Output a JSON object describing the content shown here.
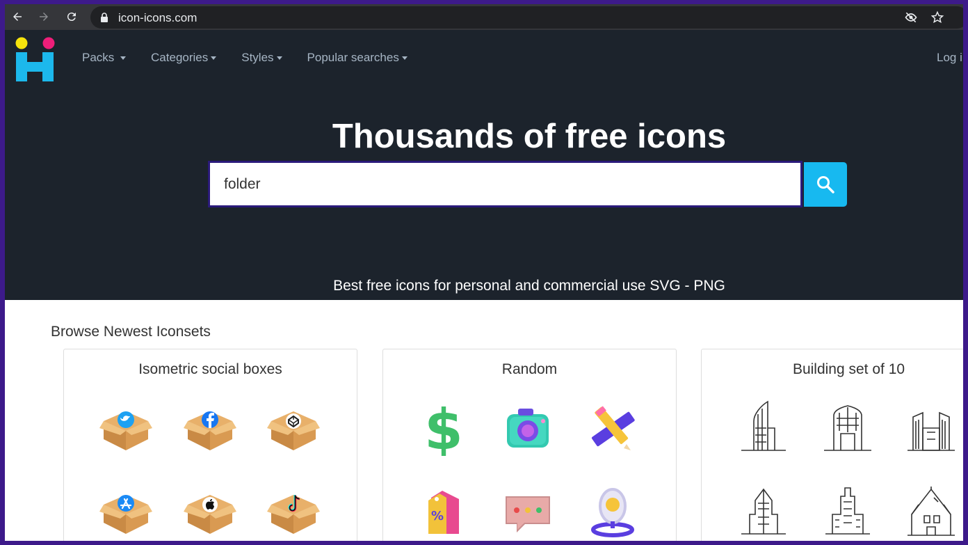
{
  "browser": {
    "url": "icon-icons.com"
  },
  "header": {
    "nav": [
      {
        "label": "Packs"
      },
      {
        "label": "Categories"
      },
      {
        "label": "Styles"
      },
      {
        "label": "Popular searches"
      }
    ],
    "login_label": "Log i"
  },
  "hero": {
    "title": "Thousands of free icons",
    "search_value": "folder",
    "tagline": "Best free icons for personal and commercial use SVG - PNG"
  },
  "browse": {
    "title": "Browse Newest Iconsets",
    "cards": [
      {
        "title": "Isometric social boxes",
        "icons": [
          "twitter-box-icon",
          "facebook-box-icon",
          "codepen-box-icon",
          "app-store-box-icon",
          "apple-box-icon",
          "tiktok-box-icon"
        ]
      },
      {
        "title": "Random",
        "icons": [
          "dollar-icon",
          "camera-icon",
          "pencil-ruler-icon",
          "price-tag-icon",
          "chat-bubble-icon",
          "mirror-icon"
        ]
      },
      {
        "title": "Building set of 10",
        "icons": [
          "skyscraper-icon",
          "arch-building-icon",
          "twin-tower-icon",
          "tower-icon",
          "tall-tower-icon",
          "haunted-house-icon"
        ]
      }
    ]
  },
  "colors": {
    "header_bg": "#1c232c",
    "accent": "#17b9f0",
    "logo_yellow": "#f5e30c",
    "logo_pink": "#ee1e79",
    "logo_cyan": "#1cb8ec"
  }
}
